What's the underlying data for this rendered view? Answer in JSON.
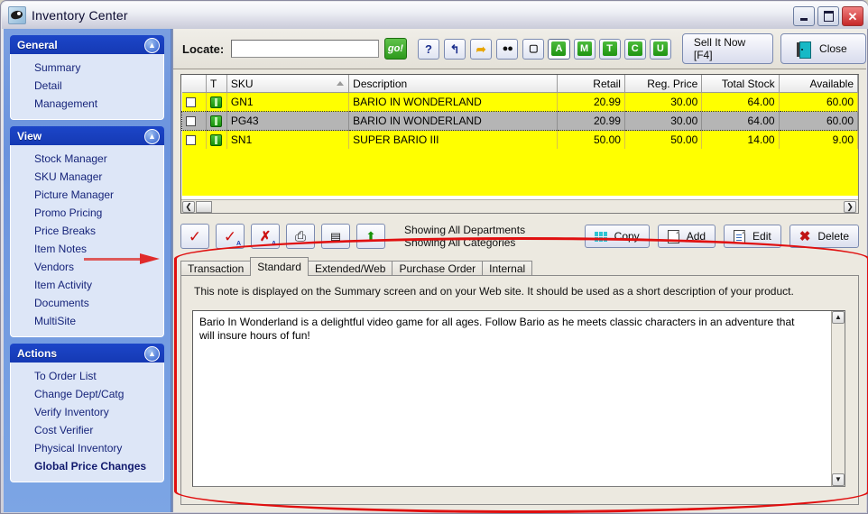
{
  "window": {
    "title": "Inventory Center",
    "icon": "inventory-app-icon",
    "controls": {
      "minimize": "–",
      "maximize": "□",
      "close": "✕"
    }
  },
  "sidebar": {
    "panels": [
      {
        "title": "General",
        "collapse_icon": "chevron-up-icon",
        "items": [
          {
            "label": "Summary",
            "bold": false
          },
          {
            "label": "Detail",
            "bold": false
          },
          {
            "label": "Management",
            "bold": false
          }
        ]
      },
      {
        "title": "View",
        "collapse_icon": "chevron-up-icon",
        "items": [
          {
            "label": "Stock Manager",
            "bold": false
          },
          {
            "label": "SKU Manager",
            "bold": false
          },
          {
            "label": "Picture Manager",
            "bold": false
          },
          {
            "label": "Promo Pricing",
            "bold": false
          },
          {
            "label": "Price Breaks",
            "bold": false
          },
          {
            "label": "Item Notes",
            "bold": false
          },
          {
            "label": "Vendors",
            "bold": false
          },
          {
            "label": "Item Activity",
            "bold": false
          },
          {
            "label": "Documents",
            "bold": false
          },
          {
            "label": "MultiSite",
            "bold": false
          }
        ]
      },
      {
        "title": "Actions",
        "collapse_icon": "chevron-up-icon",
        "items": [
          {
            "label": "To Order List",
            "bold": false
          },
          {
            "label": "Change Dept/Catg",
            "bold": false
          },
          {
            "label": "Verify Inventory",
            "bold": false
          },
          {
            "label": "Cost Verifier",
            "bold": false
          },
          {
            "label": "Physical Inventory",
            "bold": false
          },
          {
            "label": "Global Price Changes",
            "bold": true
          }
        ]
      }
    ]
  },
  "toolbar": {
    "locate_label": "Locate:",
    "locate_value": "",
    "locate_placeholder": "",
    "go_label": "go!",
    "icon_buttons": [
      {
        "name": "help-icon",
        "glyph": "?"
      },
      {
        "name": "refresh-icon",
        "glyph": "↰"
      },
      {
        "name": "jump-arrow-icon",
        "glyph": "↖"
      },
      {
        "name": "find-binoculars-icon",
        "glyph": "M"
      },
      {
        "name": "preview-page-icon",
        "glyph": "🔍"
      }
    ],
    "letter_buttons": [
      {
        "label": "A",
        "selected": true
      },
      {
        "label": "M",
        "selected": false
      },
      {
        "label": "T",
        "selected": false
      },
      {
        "label": "C",
        "selected": false
      },
      {
        "label": "U",
        "selected": false
      }
    ],
    "sell_now_label": "Sell It Now [F4]",
    "close_label": "Close",
    "close_icon": "exit-door-icon"
  },
  "grid": {
    "columns": [
      {
        "label": "",
        "key": "check",
        "align": "left"
      },
      {
        "label": "T",
        "key": "type",
        "align": "left"
      },
      {
        "label": "SKU",
        "key": "sku",
        "align": "left",
        "sorted": true
      },
      {
        "label": "Description",
        "key": "description",
        "align": "left"
      },
      {
        "label": "Retail",
        "key": "retail",
        "align": "right"
      },
      {
        "label": "Reg. Price",
        "key": "reg_price",
        "align": "right"
      },
      {
        "label": "Total Stock",
        "key": "total_stock",
        "align": "right"
      },
      {
        "label": "Available",
        "key": "available",
        "align": "right"
      }
    ],
    "rows": [
      {
        "checked": false,
        "type_icon": "green-status-icon",
        "sku": "GN1",
        "description": "BARIO IN WONDERLAND",
        "retail": "20.99",
        "retail_highlight": true,
        "reg_price": "30.00",
        "total_stock": "64.00",
        "available": "60.00",
        "selected": false
      },
      {
        "checked": false,
        "type_icon": "green-status-icon",
        "sku": "PG43",
        "description": "BARIO IN WONDERLAND",
        "retail": "20.99",
        "retail_highlight": false,
        "reg_price": "30.00",
        "total_stock": "64.00",
        "available": "60.00",
        "selected": true
      },
      {
        "checked": false,
        "type_icon": "green-status-icon",
        "sku": "SN1",
        "description": "SUPER BARIO III",
        "retail": "50.00",
        "retail_highlight": false,
        "reg_price": "50.00",
        "total_stock": "14.00",
        "available": "9.00",
        "selected": false
      }
    ],
    "scroll_left_glyph": "❮",
    "scroll_right_glyph": "❯"
  },
  "actions": {
    "icon_buttons": [
      {
        "name": "check-mark-icon",
        "glyph": "✔"
      },
      {
        "name": "check-all-icon",
        "glyph": "✔"
      },
      {
        "name": "uncheck-all-icon",
        "glyph": "✘"
      },
      {
        "name": "print-icon",
        "glyph": "⎙"
      },
      {
        "name": "list-view-icon",
        "glyph": "▤"
      },
      {
        "name": "export-up-icon",
        "glyph": "⬆"
      }
    ],
    "status_line1": "Showing All Departments",
    "status_line2": "Showing All Categories",
    "buttons": [
      {
        "label": "Copy",
        "icon": "copy-grid-icon"
      },
      {
        "label": "Add",
        "icon": "new-page-icon"
      },
      {
        "label": "Edit",
        "icon": "edit-page-icon"
      },
      {
        "label": "Delete",
        "icon": "delete-x-icon"
      }
    ]
  },
  "notes": {
    "tabs": [
      {
        "label": "Transaction",
        "active": false
      },
      {
        "label": "Standard",
        "active": true
      },
      {
        "label": "Extended/Web",
        "active": false
      },
      {
        "label": "Purchase Order",
        "active": false
      },
      {
        "label": "Internal",
        "active": false
      }
    ],
    "hint": "This note is displayed on the Summary screen and on your Web site.  It should be used as a short description of your product.",
    "text": "Bario In Wonderland is a delightful video game for all ages.  Follow Bario as he meets classic characters in an adventure that will insure hours of fun!",
    "scroll_up_glyph": "▲",
    "scroll_down_glyph": "▼"
  },
  "annotations": {
    "arrow_target": "Item Notes",
    "oval_target": "notes-panel",
    "color": "#e01010"
  }
}
